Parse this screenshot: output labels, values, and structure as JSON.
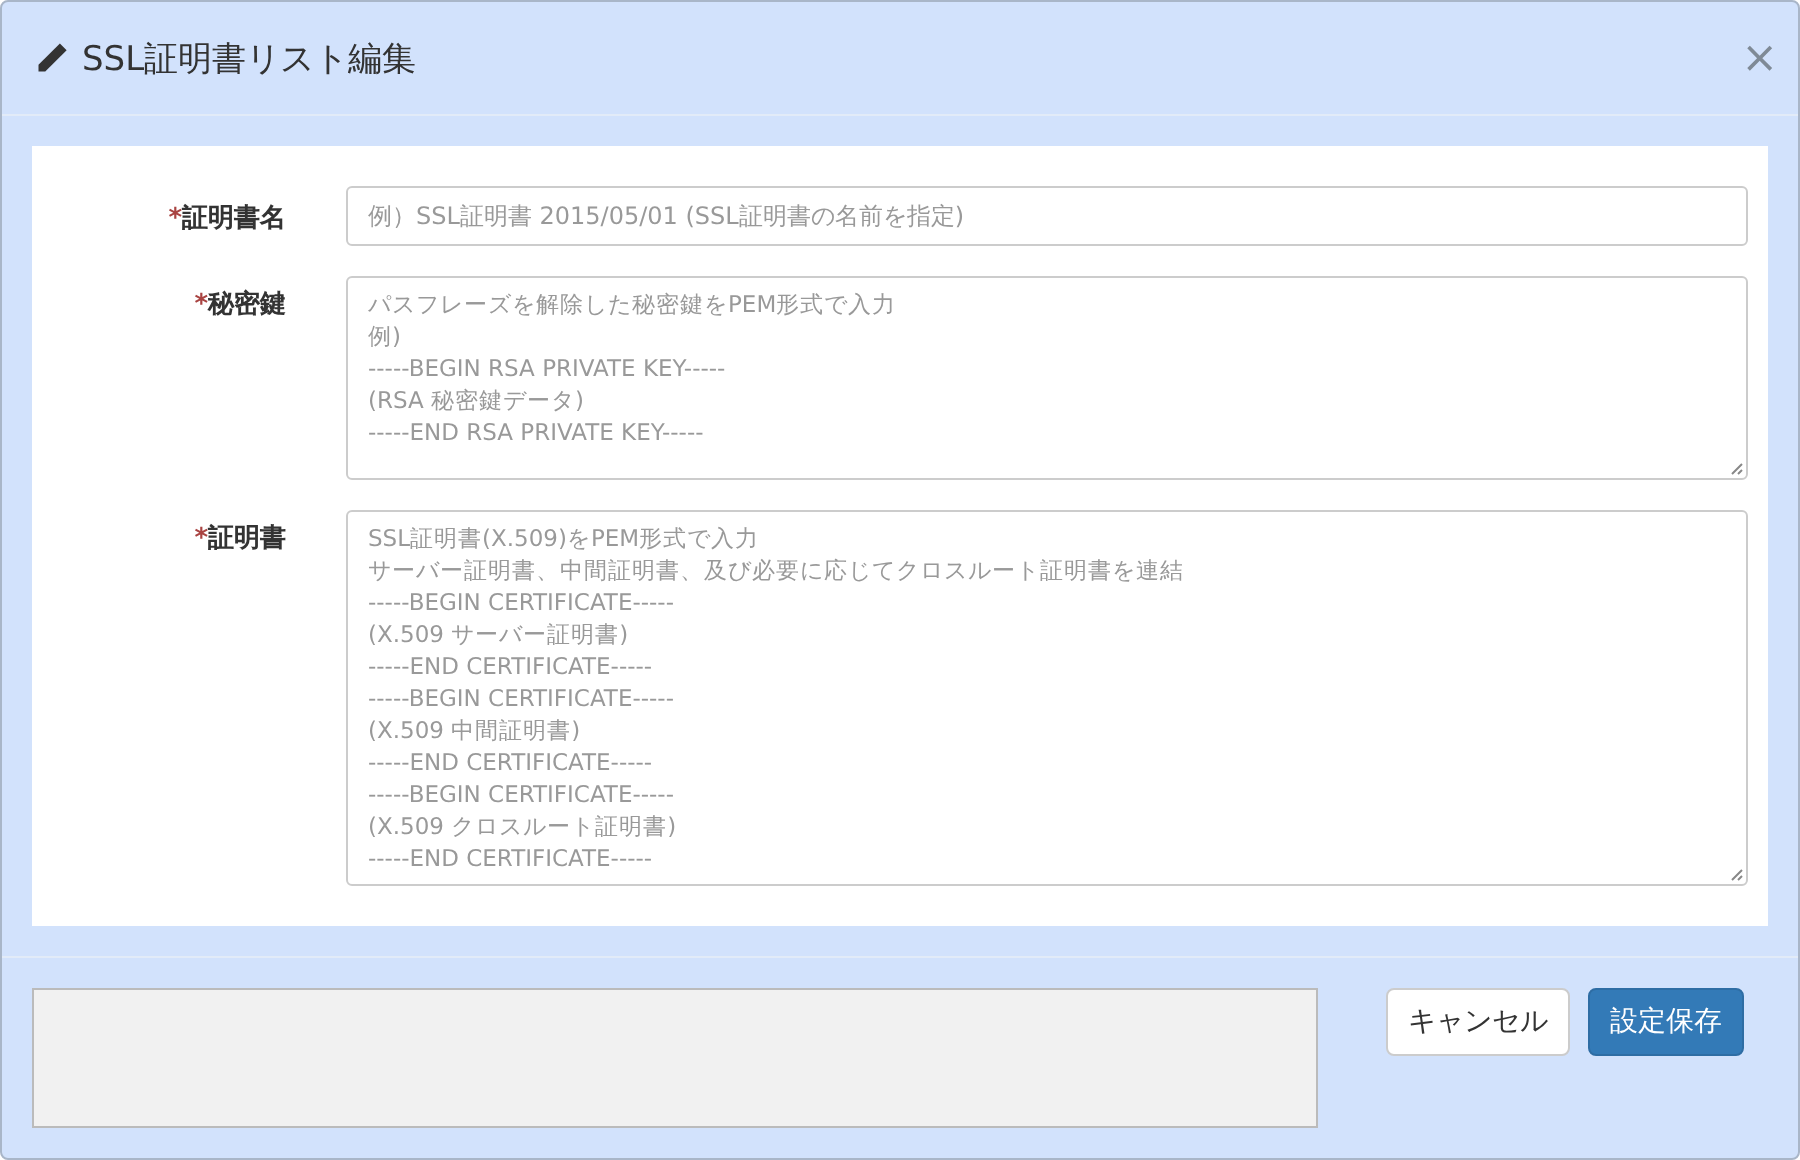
{
  "dialog": {
    "title": "SSL証明書リスト編集",
    "close": "×"
  },
  "fields": [
    {
      "kind": "input",
      "mark": "*",
      "label": "証明書名",
      "placeholder": "例）SSL証明書 2015/05/01 (SSL証明書の名前を指定)"
    },
    {
      "kind": "textarea",
      "mark": "*",
      "label": "秘密鍵",
      "placeholder_lines": [
        "パスフレーズを解除した秘密鍵をPEM形式で入力",
        "例)",
        "-----BEGIN RSA PRIVATE KEY-----",
        "(RSA 秘密鍵データ)",
        "-----END RSA PRIVATE KEY-----"
      ]
    },
    {
      "kind": "textarea",
      "mark": "*",
      "label": "証明書",
      "placeholder_lines": [
        "SSL証明書(X.509)をPEM形式で入力",
        "サーバー証明書、中間証明書、及び必要に応じてクロスルート証明書を連結",
        "-----BEGIN CERTIFICATE-----",
        "(X.509 サーバー証明書)",
        "-----END CERTIFICATE-----",
        "-----BEGIN CERTIFICATE-----",
        "(X.509 中間証明書)",
        "-----END CERTIFICATE-----",
        "-----BEGIN CERTIFICATE-----",
        "(X.509 クロスルート証明書)",
        "-----END CERTIFICATE-----"
      ]
    }
  ],
  "buttons": [
    {
      "kind": "default",
      "label": "キャンセル"
    },
    {
      "kind": "primary",
      "label": "設定保存"
    }
  ]
}
